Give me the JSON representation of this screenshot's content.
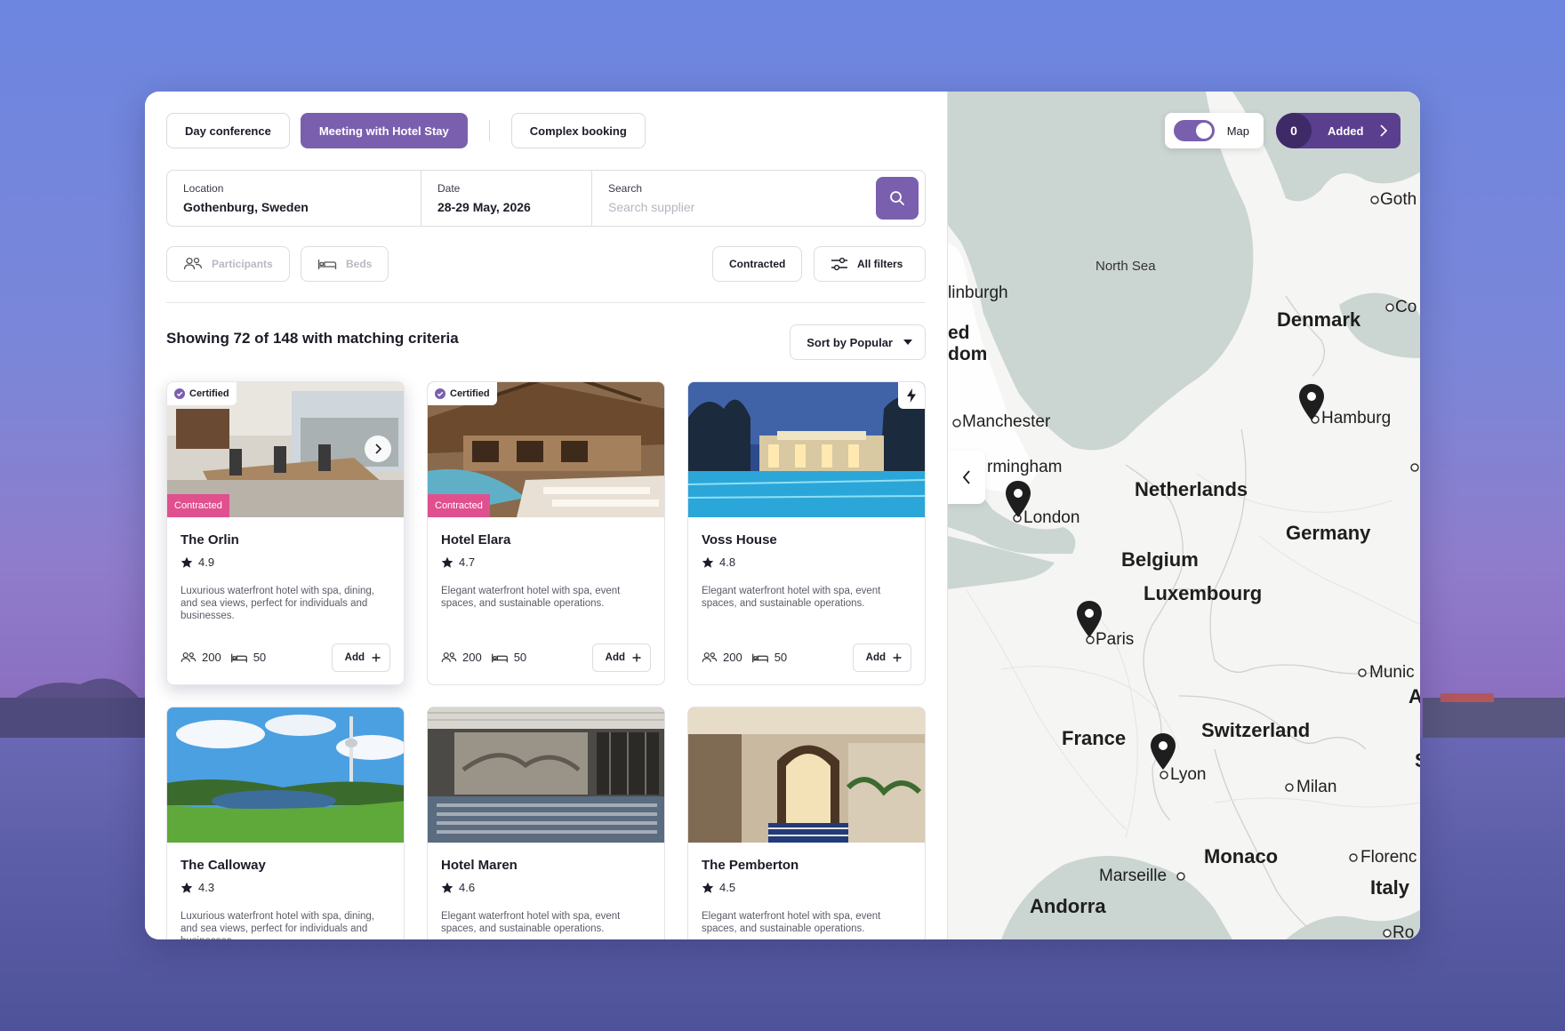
{
  "tabs": [
    {
      "label": "Day conference",
      "active": false
    },
    {
      "label": "Meeting with Hotel Stay",
      "active": true
    },
    {
      "label": "Complex booking",
      "active": false
    }
  ],
  "search": {
    "location_label": "Location",
    "location_value": "Gothenburg, Sweden",
    "date_label": "Date",
    "date_value": "28-29 May, 2026",
    "supplier_label": "Search",
    "supplier_placeholder": "Search supplier"
  },
  "filters": {
    "participants": "Participants",
    "beds": "Beds",
    "contracted": "Contracted",
    "all_filters": "All filters"
  },
  "results": {
    "summary": "Showing 72 of 148 with matching criteria",
    "sort_label": "Sort by Popular"
  },
  "badges": {
    "certified": "Certified",
    "contracted": "Contracted"
  },
  "add_label": "Add",
  "hotels": [
    {
      "name": "The Orlin",
      "rating": "4.9",
      "desc": "Luxurious waterfront hotel with spa, dining, and sea views, perfect for individuals and businesses.",
      "participants": "200",
      "beds": "50",
      "certified": true,
      "contracted": true
    },
    {
      "name": "Hotel Elara",
      "rating": "4.7",
      "desc": "Elegant waterfront hotel with spa, event spaces, and sustainable operations.",
      "participants": "200",
      "beds": "50",
      "certified": true,
      "contracted": true
    },
    {
      "name": "Voss House",
      "rating": "4.8",
      "desc": "Elegant waterfront hotel with spa, event spaces, and sustainable operations.",
      "participants": "200",
      "beds": "50",
      "certified": false,
      "contracted": false
    },
    {
      "name": "The Calloway",
      "rating": "4.3",
      "desc": "Luxurious waterfront hotel with spa, dining, and sea views, perfect for individuals and businesses."
    },
    {
      "name": "Hotel Maren",
      "rating": "4.6",
      "desc": "Elegant waterfront hotel with spa, event spaces, and sustainable operations."
    },
    {
      "name": "The Pemberton",
      "rating": "4.5",
      "desc": "Elegant waterfront hotel with spa, event spaces, and sustainable operations."
    }
  ],
  "map": {
    "toggle_label": "Map",
    "added_count": "0",
    "added_label": "Added",
    "labels": {
      "north_sea": "North Sea",
      "goth": "Goth",
      "co": "Co",
      "edinburgh": "linburgh",
      "ed": "ed",
      "dom": "dom",
      "denmark": "Denmark",
      "manchester": "Manchester",
      "hamburg": "Hamburg",
      "birmingham": "rmingham",
      "netherlands": "Netherlands",
      "london": "London",
      "germany": "Germany",
      "belgium": "Belgium",
      "luxembourg": "Luxembourg",
      "paris": "Paris",
      "munich": "Munic",
      "a": "A",
      "france": "France",
      "switzerland": "Switzerland",
      "s": "S",
      "lyon": "Lyon",
      "milan": "Milan",
      "monaco": "Monaco",
      "florence": "Florenc",
      "marseille": "Marseille",
      "italy": "Italy",
      "andorra": "Andorra",
      "rome": "Ro"
    }
  },
  "colors": {
    "accent": "#7a5fae",
    "accent_dark": "#5a3f8f",
    "contracted": "#e0508f"
  }
}
